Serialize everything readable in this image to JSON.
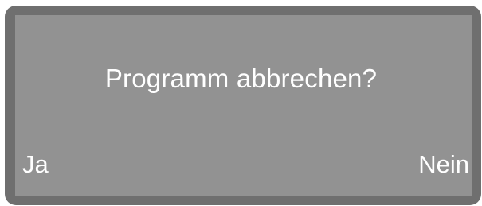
{
  "display": {
    "prompt": "Programm abbrechen?",
    "softkeys": {
      "left_label": "Ja",
      "right_label": "Nein"
    },
    "colors": {
      "bezel": "#6f6f6f",
      "screen": "#929292",
      "text": "#ffffff"
    }
  }
}
